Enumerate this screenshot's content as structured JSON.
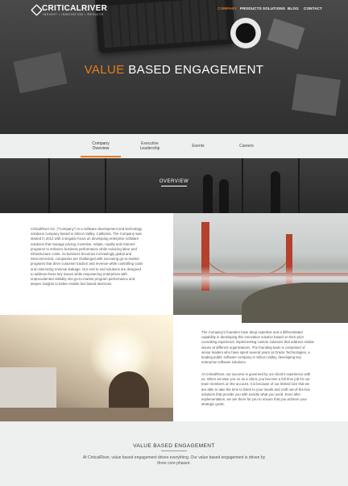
{
  "header": {
    "logo_text": "CRITICALRIVER",
    "logo_tagline": "INSIGHT • INNOVATION • RESULTS",
    "nav": [
      {
        "label": "COMPANY"
      },
      {
        "label": "PRODUCTS"
      },
      {
        "label": "SOLUTIONS"
      },
      {
        "label": "BLOG"
      },
      {
        "label": "CONTACT"
      }
    ]
  },
  "hero": {
    "title_accent": "VALUE",
    "title_rest": "BASED ENGAGEMENT"
  },
  "tabs": [
    {
      "line1": "Company",
      "line2": "Overview"
    },
    {
      "line1": "Executive",
      "line2": "Leadership"
    },
    {
      "line1": "Events",
      "line2": ""
    },
    {
      "line1": "Careers",
      "line2": ""
    }
  ],
  "overview": {
    "title": "OVERVIEW"
  },
  "section1": {
    "text": "CriticalRiver Inc. (\"Company\") is a software development and technology solutions company based in Silicon Valley, California. The Company was started in 2014 with a singular focus on developing enterprise software solutions that manage pricing, incentive, rebate, royalty and channel programs to enhance business performance while reducing labor and infrastructure costs. As business becomes increasingly global and interconnected, companies are challenged with executing go-to-market programs that drive customer traction and revenue while controlling costs and minimizing revenue leakage. Our end to end solutions are designed to address these key issues while empowering enterprises with unprecedented visibility into go-to-market program performance and deeper insights to better enable fact based decisions."
  },
  "section2": {
    "p1": "The Company's founders have deep expertise and a differentiated capability in developing this innovative solution based on their prior consulting experience implementing custom solutions that address similar issues at different organizations. The founding team is comprised of senior leaders who have spent several years at Oracle Technologies, a leading public software company in Silicon Valley, developing key enterprise software solutions.",
    "p2": "At CriticalRiver, our success is governed by our client's experience with us. When we take you on as a client, you become a full time job for our team members on the account. It is because of our limited size that we are able to take the time to listen to your needs and craft out-of-the-box solutions that provide you with exactly what you need. Even after implementation, we are there for you to ensure that you achieve your strategic goals."
  },
  "value_section": {
    "title": "VALUE BASED ENGAGEMENT",
    "text": "At CriticalRiver, value based engagement drives everything. Our value based engagement is driven by three core phases:"
  },
  "colors": {
    "accent": "#e87d1e"
  }
}
